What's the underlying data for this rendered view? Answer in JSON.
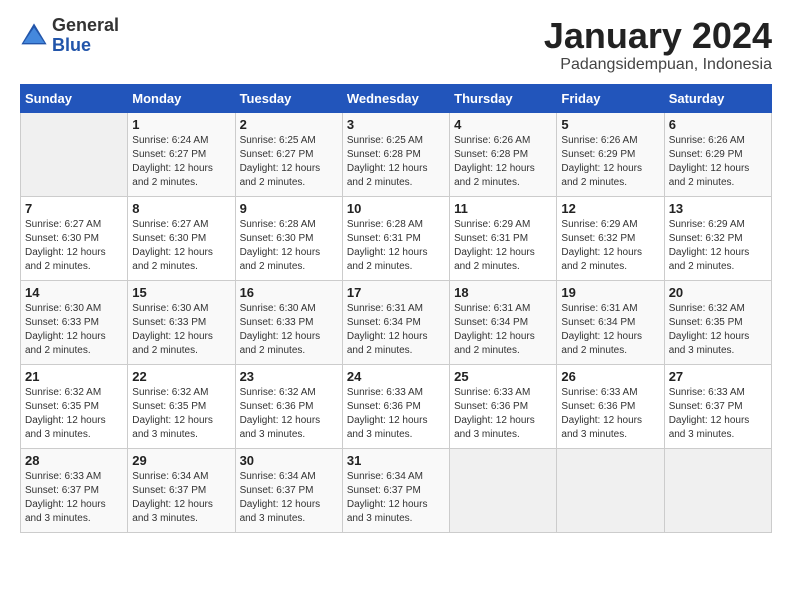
{
  "header": {
    "logo_general": "General",
    "logo_blue": "Blue",
    "title": "January 2024",
    "subtitle": "Padangsidempuan, Indonesia"
  },
  "calendar": {
    "days_of_week": [
      "Sunday",
      "Monday",
      "Tuesday",
      "Wednesday",
      "Thursday",
      "Friday",
      "Saturday"
    ],
    "weeks": [
      [
        {
          "day": "",
          "info": ""
        },
        {
          "day": "1",
          "info": "Sunrise: 6:24 AM\nSunset: 6:27 PM\nDaylight: 12 hours and 2 minutes."
        },
        {
          "day": "2",
          "info": "Sunrise: 6:25 AM\nSunset: 6:27 PM\nDaylight: 12 hours and 2 minutes."
        },
        {
          "day": "3",
          "info": "Sunrise: 6:25 AM\nSunset: 6:28 PM\nDaylight: 12 hours and 2 minutes."
        },
        {
          "day": "4",
          "info": "Sunrise: 6:26 AM\nSunset: 6:28 PM\nDaylight: 12 hours and 2 minutes."
        },
        {
          "day": "5",
          "info": "Sunrise: 6:26 AM\nSunset: 6:29 PM\nDaylight: 12 hours and 2 minutes."
        },
        {
          "day": "6",
          "info": "Sunrise: 6:26 AM\nSunset: 6:29 PM\nDaylight: 12 hours and 2 minutes."
        }
      ],
      [
        {
          "day": "7",
          "info": "Sunrise: 6:27 AM\nSunset: 6:30 PM\nDaylight: 12 hours and 2 minutes."
        },
        {
          "day": "8",
          "info": "Sunrise: 6:27 AM\nSunset: 6:30 PM\nDaylight: 12 hours and 2 minutes."
        },
        {
          "day": "9",
          "info": "Sunrise: 6:28 AM\nSunset: 6:30 PM\nDaylight: 12 hours and 2 minutes."
        },
        {
          "day": "10",
          "info": "Sunrise: 6:28 AM\nSunset: 6:31 PM\nDaylight: 12 hours and 2 minutes."
        },
        {
          "day": "11",
          "info": "Sunrise: 6:29 AM\nSunset: 6:31 PM\nDaylight: 12 hours and 2 minutes."
        },
        {
          "day": "12",
          "info": "Sunrise: 6:29 AM\nSunset: 6:32 PM\nDaylight: 12 hours and 2 minutes."
        },
        {
          "day": "13",
          "info": "Sunrise: 6:29 AM\nSunset: 6:32 PM\nDaylight: 12 hours and 2 minutes."
        }
      ],
      [
        {
          "day": "14",
          "info": "Sunrise: 6:30 AM\nSunset: 6:33 PM\nDaylight: 12 hours and 2 minutes."
        },
        {
          "day": "15",
          "info": "Sunrise: 6:30 AM\nSunset: 6:33 PM\nDaylight: 12 hours and 2 minutes."
        },
        {
          "day": "16",
          "info": "Sunrise: 6:30 AM\nSunset: 6:33 PM\nDaylight: 12 hours and 2 minutes."
        },
        {
          "day": "17",
          "info": "Sunrise: 6:31 AM\nSunset: 6:34 PM\nDaylight: 12 hours and 2 minutes."
        },
        {
          "day": "18",
          "info": "Sunrise: 6:31 AM\nSunset: 6:34 PM\nDaylight: 12 hours and 2 minutes."
        },
        {
          "day": "19",
          "info": "Sunrise: 6:31 AM\nSunset: 6:34 PM\nDaylight: 12 hours and 2 minutes."
        },
        {
          "day": "20",
          "info": "Sunrise: 6:32 AM\nSunset: 6:35 PM\nDaylight: 12 hours and 3 minutes."
        }
      ],
      [
        {
          "day": "21",
          "info": "Sunrise: 6:32 AM\nSunset: 6:35 PM\nDaylight: 12 hours and 3 minutes."
        },
        {
          "day": "22",
          "info": "Sunrise: 6:32 AM\nSunset: 6:35 PM\nDaylight: 12 hours and 3 minutes."
        },
        {
          "day": "23",
          "info": "Sunrise: 6:32 AM\nSunset: 6:36 PM\nDaylight: 12 hours and 3 minutes."
        },
        {
          "day": "24",
          "info": "Sunrise: 6:33 AM\nSunset: 6:36 PM\nDaylight: 12 hours and 3 minutes."
        },
        {
          "day": "25",
          "info": "Sunrise: 6:33 AM\nSunset: 6:36 PM\nDaylight: 12 hours and 3 minutes."
        },
        {
          "day": "26",
          "info": "Sunrise: 6:33 AM\nSunset: 6:36 PM\nDaylight: 12 hours and 3 minutes."
        },
        {
          "day": "27",
          "info": "Sunrise: 6:33 AM\nSunset: 6:37 PM\nDaylight: 12 hours and 3 minutes."
        }
      ],
      [
        {
          "day": "28",
          "info": "Sunrise: 6:33 AM\nSunset: 6:37 PM\nDaylight: 12 hours and 3 minutes."
        },
        {
          "day": "29",
          "info": "Sunrise: 6:34 AM\nSunset: 6:37 PM\nDaylight: 12 hours and 3 minutes."
        },
        {
          "day": "30",
          "info": "Sunrise: 6:34 AM\nSunset: 6:37 PM\nDaylight: 12 hours and 3 minutes."
        },
        {
          "day": "31",
          "info": "Sunrise: 6:34 AM\nSunset: 6:37 PM\nDaylight: 12 hours and 3 minutes."
        },
        {
          "day": "",
          "info": ""
        },
        {
          "day": "",
          "info": ""
        },
        {
          "day": "",
          "info": ""
        }
      ]
    ]
  }
}
